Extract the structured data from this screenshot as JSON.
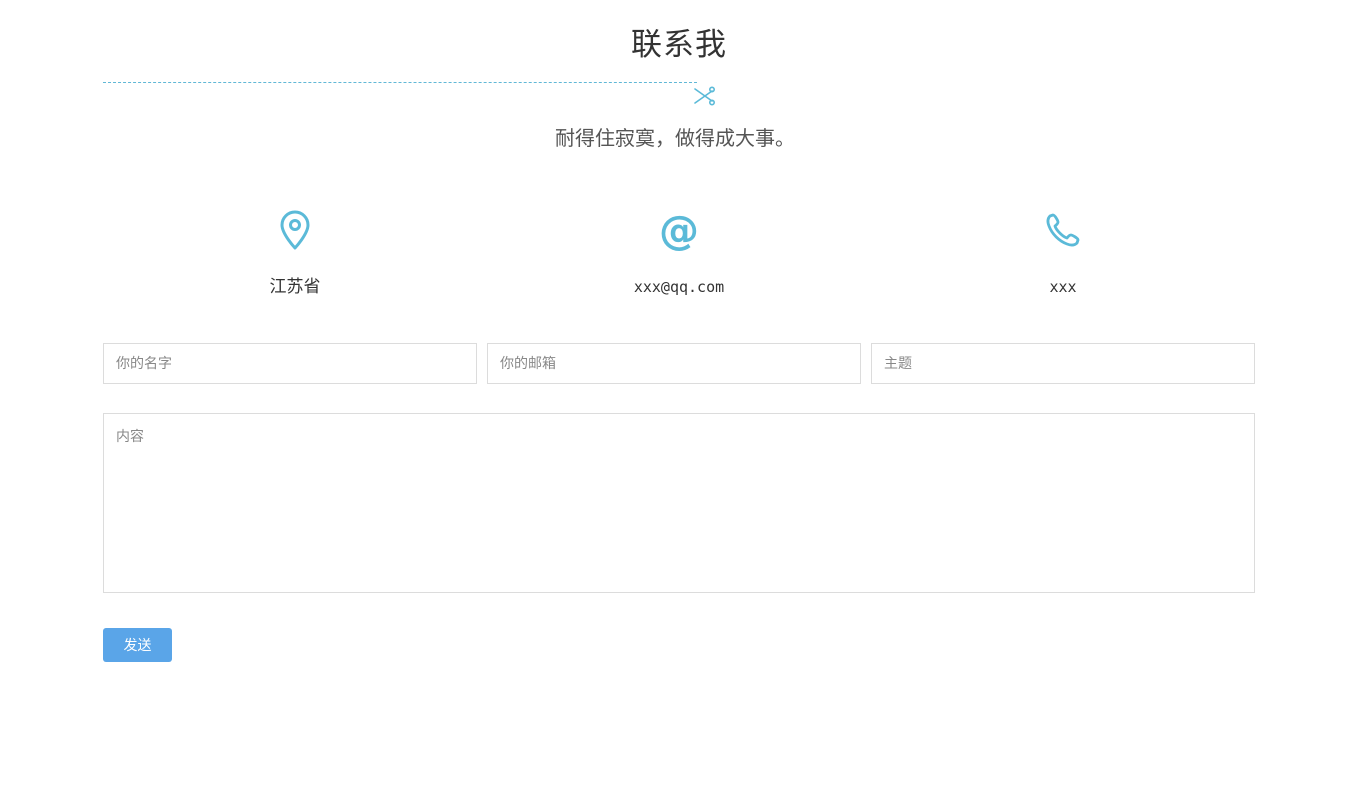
{
  "header": {
    "title": "联系我",
    "subtitle": "耐得住寂寞，做得成大事。"
  },
  "contact_info": [
    {
      "icon": "location-pin-icon",
      "text": "江苏省"
    },
    {
      "icon": "at-sign-icon",
      "text": "xxx@qq.com"
    },
    {
      "icon": "phone-icon",
      "text": "xxx"
    }
  ],
  "form": {
    "name_placeholder": "你的名字",
    "email_placeholder": "你的邮箱",
    "subject_placeholder": "主题",
    "content_placeholder": "内容",
    "send_label": "发送"
  },
  "colors": {
    "accent": "#5bbad8",
    "button": "#5aa5e8"
  }
}
